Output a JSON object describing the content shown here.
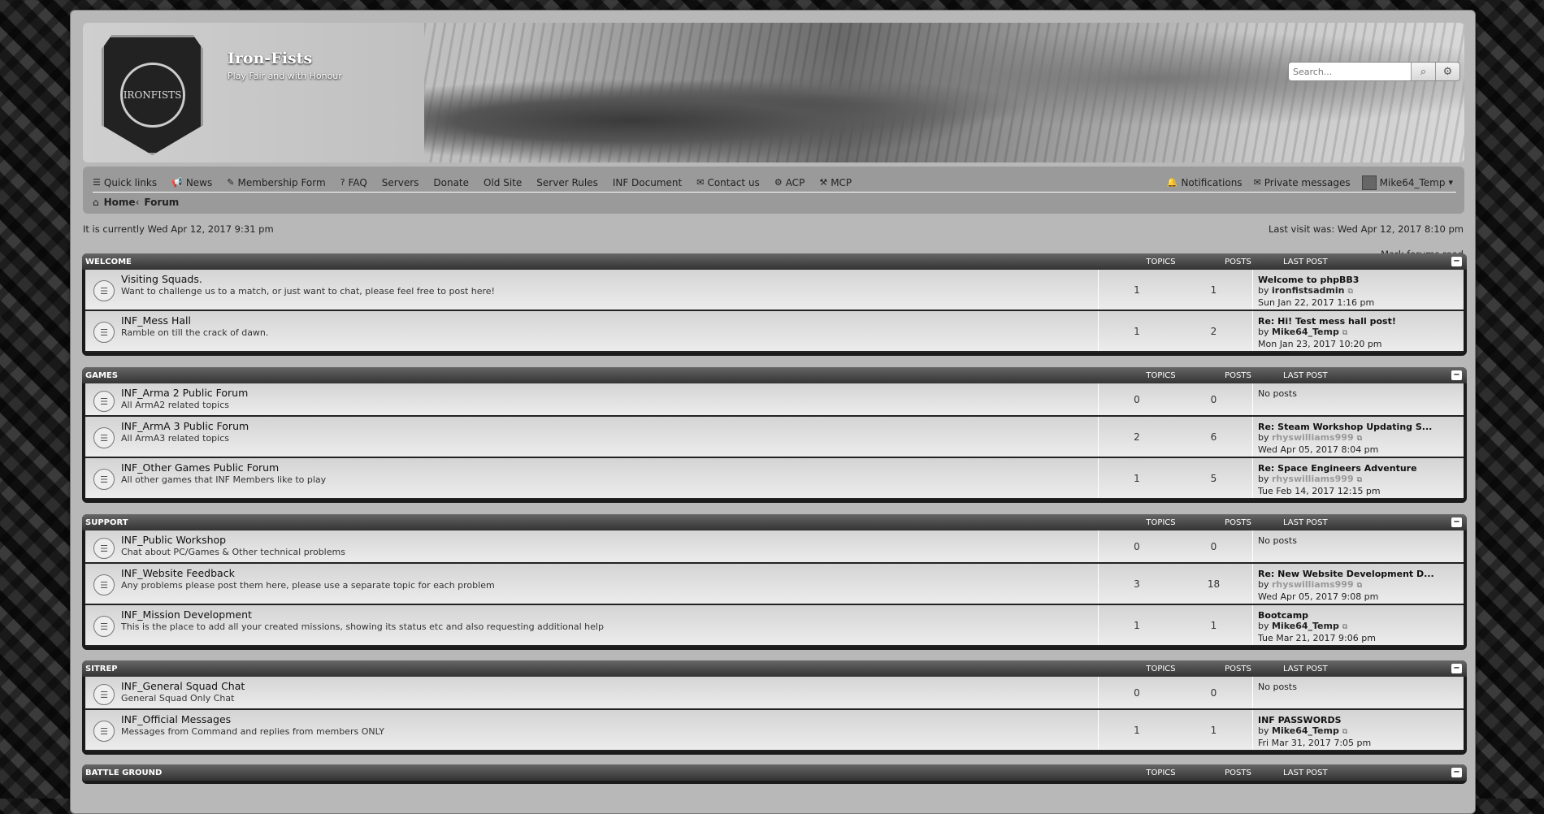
{
  "site": {
    "title": "Iron-Fists",
    "description": "Play Fair and with Honour",
    "logo_text": "IRONFISTS"
  },
  "search": {
    "placeholder": "Search..."
  },
  "nav": {
    "left": [
      {
        "label": "Quick links",
        "icon": "hamburger-icon"
      },
      {
        "label": "News",
        "icon": "megaphone-icon"
      },
      {
        "label": "Membership Form",
        "icon": "pencil-icon"
      },
      {
        "label": "FAQ",
        "icon": "question-icon"
      },
      {
        "label": "Servers",
        "icon": ""
      },
      {
        "label": "Donate",
        "icon": ""
      },
      {
        "label": "Old Site",
        "icon": ""
      },
      {
        "label": "Server Rules",
        "icon": ""
      },
      {
        "label": "INF Document",
        "icon": ""
      },
      {
        "label": "Contact us",
        "icon": "envelope-icon"
      },
      {
        "label": "ACP",
        "icon": "gears-icon"
      },
      {
        "label": "MCP",
        "icon": "gavel-icon"
      }
    ],
    "right": [
      {
        "label": "Notifications",
        "icon": "bell-icon"
      },
      {
        "label": "Private messages",
        "icon": "inbox-icon"
      },
      {
        "label": "Mike64_Temp",
        "icon": "avatar-icon"
      }
    ]
  },
  "breadcrumb": {
    "home": "Home",
    "forum": "Forum"
  },
  "time": {
    "current": "It is currently Wed Apr 12, 2017 9:31 pm",
    "last_visit": "Last visit was: Wed Apr 12, 2017 8:10 pm"
  },
  "mark_read": "Mark forums read",
  "columns": {
    "topics": "TOPICS",
    "posts": "POSTS",
    "last_post": "LAST POST"
  },
  "categories": [
    {
      "name": "WELCOME",
      "forums": [
        {
          "name": "Visiting Squads.",
          "desc": "Want to challenge us to a match, or just want to chat, please feel free to post here!",
          "topics": "1",
          "posts": "1",
          "last_title": "Welcome to phpBB3",
          "by": "by",
          "user": "ironfistsadmin",
          "user_grey": false,
          "date": "Sun Jan 22, 2017 1:16 pm"
        },
        {
          "name": "INF_Mess Hall",
          "desc": "Ramble on till the crack of dawn.",
          "topics": "1",
          "posts": "2",
          "last_title": "Re: Hi! Test mess hall post!",
          "by": "by",
          "user": "Mike64_Temp",
          "user_grey": false,
          "date": "Mon Jan 23, 2017 10:20 pm"
        }
      ]
    },
    {
      "name": "GAMES",
      "forums": [
        {
          "name": "INF_Arma 2 Public Forum",
          "desc": "All ArmA2 related topics",
          "topics": "0",
          "posts": "0",
          "last_title": "",
          "no_posts": "No posts",
          "short": true
        },
        {
          "name": "INF_ArmA 3 Public Forum",
          "desc": "All ArmA3 related topics",
          "topics": "2",
          "posts": "6",
          "last_title": "Re: Steam Workshop Updating S...",
          "by": "by",
          "user": "rhyswilliams999",
          "user_grey": true,
          "date": "Wed Apr 05, 2017 8:04 pm"
        },
        {
          "name": "INF_Other Games Public Forum",
          "desc": "All other games that INF Members like to play",
          "topics": "1",
          "posts": "5",
          "last_title": "Re: Space Engineers Adventure",
          "by": "by",
          "user": "rhyswilliams999",
          "user_grey": true,
          "date": "Tue Feb 14, 2017 12:15 pm"
        }
      ]
    },
    {
      "name": "SUPPORT",
      "forums": [
        {
          "name": "INF_Public Workshop",
          "desc": "Chat about PC/Games & Other technical problems",
          "topics": "0",
          "posts": "0",
          "last_title": "",
          "no_posts": "No posts",
          "short": true
        },
        {
          "name": "INF_Website Feedback",
          "desc": "Any problems please post them here, please use a separate topic for each problem",
          "topics": "3",
          "posts": "18",
          "last_title": "Re: New Website Development D...",
          "by": "by",
          "user": "rhyswilliams999",
          "user_grey": true,
          "date": "Wed Apr 05, 2017 9:08 pm"
        },
        {
          "name": "INF_Mission Development",
          "desc": "This is the place to add all your created missions, showing its status etc and also requesting additional help",
          "topics": "1",
          "posts": "1",
          "last_title": "Bootcamp",
          "by": "by",
          "user": "Mike64_Temp",
          "user_grey": false,
          "date": "Tue Mar 21, 2017 9:06 pm"
        }
      ]
    },
    {
      "name": "SITREP",
      "forums": [
        {
          "name": "INF_General Squad Chat",
          "desc": "General Squad Only Chat",
          "topics": "0",
          "posts": "0",
          "last_title": "",
          "no_posts": "No posts",
          "short": true
        },
        {
          "name": "INF_Official Messages",
          "desc": "Messages from Command and replies from members ONLY",
          "topics": "1",
          "posts": "1",
          "last_title": "INF PASSWORDS",
          "by": "by",
          "user": "Mike64_Temp",
          "user_grey": false,
          "date": "Fri Mar 31, 2017 7:05 pm"
        }
      ]
    },
    {
      "name": "BATTLE GROUND",
      "forums": []
    }
  ]
}
